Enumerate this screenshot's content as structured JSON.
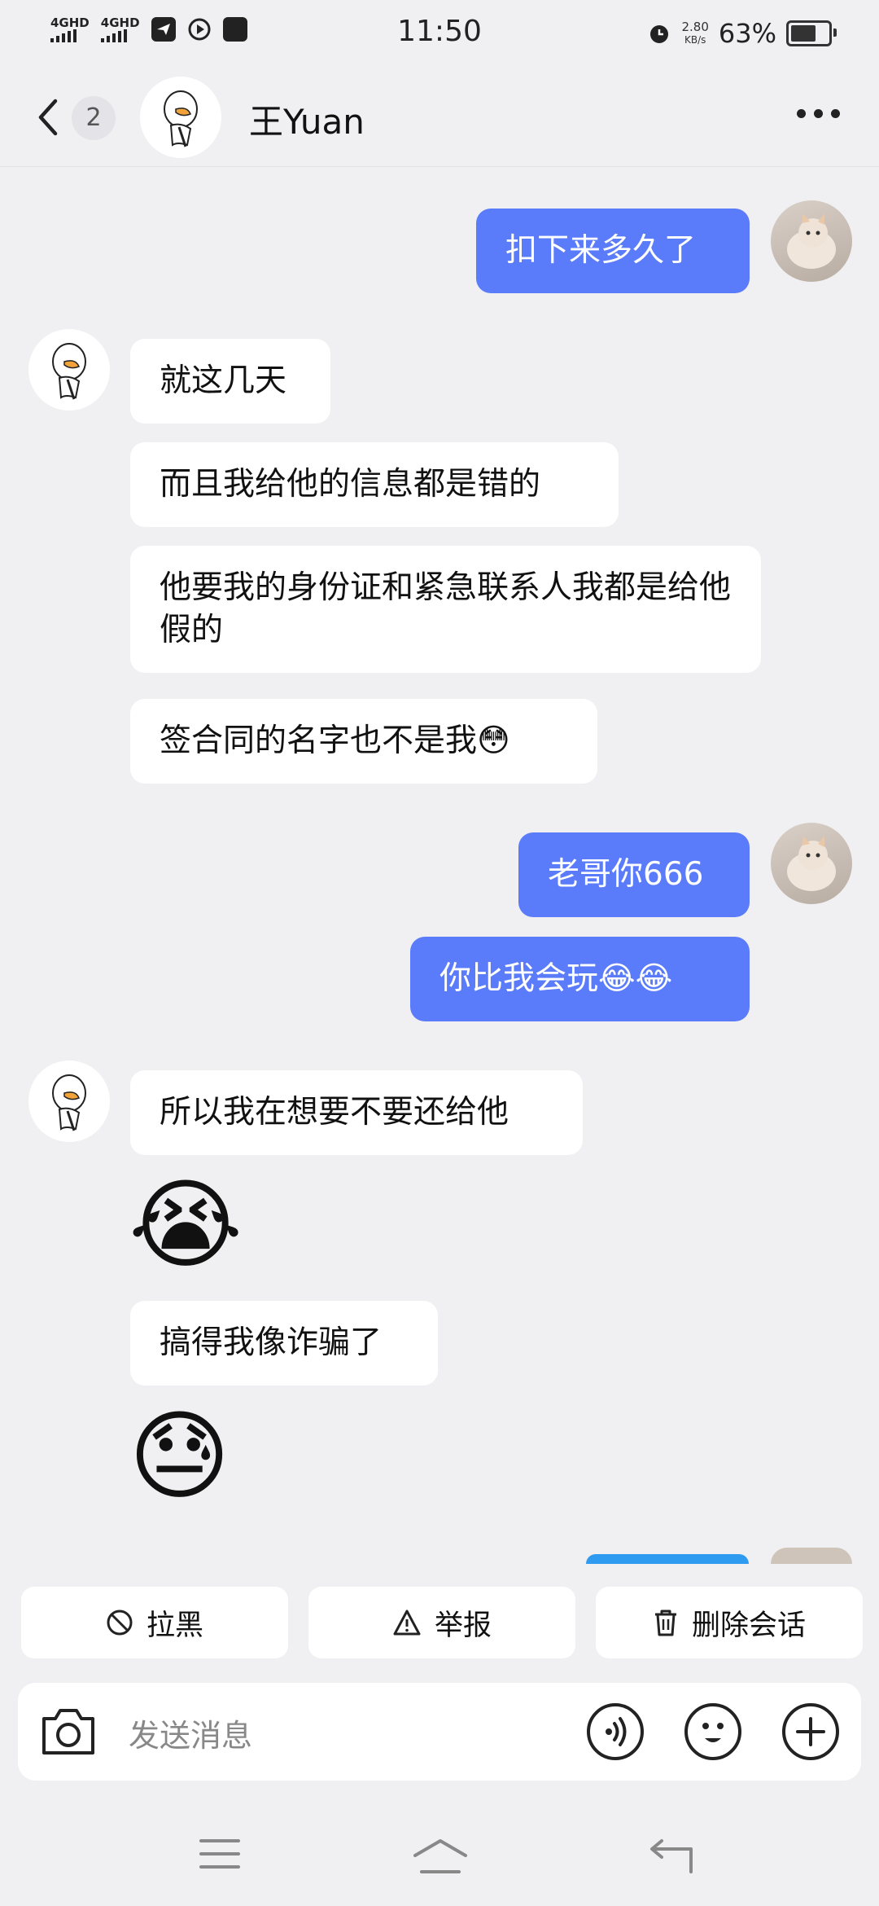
{
  "status_bar": {
    "net1": "4GHD",
    "net2": "4GHD",
    "time": "11:50",
    "speed_value": "2.80",
    "speed_unit": "KB/s",
    "battery": "63%",
    "battery_level": 0.63
  },
  "header": {
    "back_count": "2",
    "title": "王Yuan"
  },
  "messages": [
    {
      "dir": "out",
      "text": "扣下来多久了"
    },
    {
      "dir": "in",
      "text": "就这几天"
    },
    {
      "dir": "in",
      "text": "而且我给他的信息都是错的"
    },
    {
      "dir": "in",
      "text": "他要我的身份证和紧急联系人我都是给他假的"
    },
    {
      "dir": "in",
      "text": "签合同的名字也不是我😳"
    },
    {
      "dir": "out",
      "text": "老哥你666"
    },
    {
      "dir": "out",
      "text": "你比我会玩😂😂"
    },
    {
      "dir": "in",
      "text": "所以我在想要不要还给他"
    },
    {
      "dir": "in",
      "text": "😭"
    },
    {
      "dir": "in",
      "text": "搞得我像诈骗了"
    },
    {
      "dir": "in",
      "text": "😓"
    }
  ],
  "actions": {
    "block": "拉黑",
    "report": "举报",
    "delete": "删除会话"
  },
  "input": {
    "placeholder": "发送消息"
  },
  "icons": [
    "back-icon",
    "more-icon",
    "block-icon",
    "report-icon",
    "trash-icon",
    "camera-icon",
    "voice-icon",
    "emoji-icon",
    "plus-icon",
    "menu-icon",
    "home-icon",
    "return-icon"
  ],
  "colors": {
    "background": "#f0f0f2",
    "outgoing_bubble": "#5b7cfa",
    "incoming_bubble": "#ffffff"
  }
}
